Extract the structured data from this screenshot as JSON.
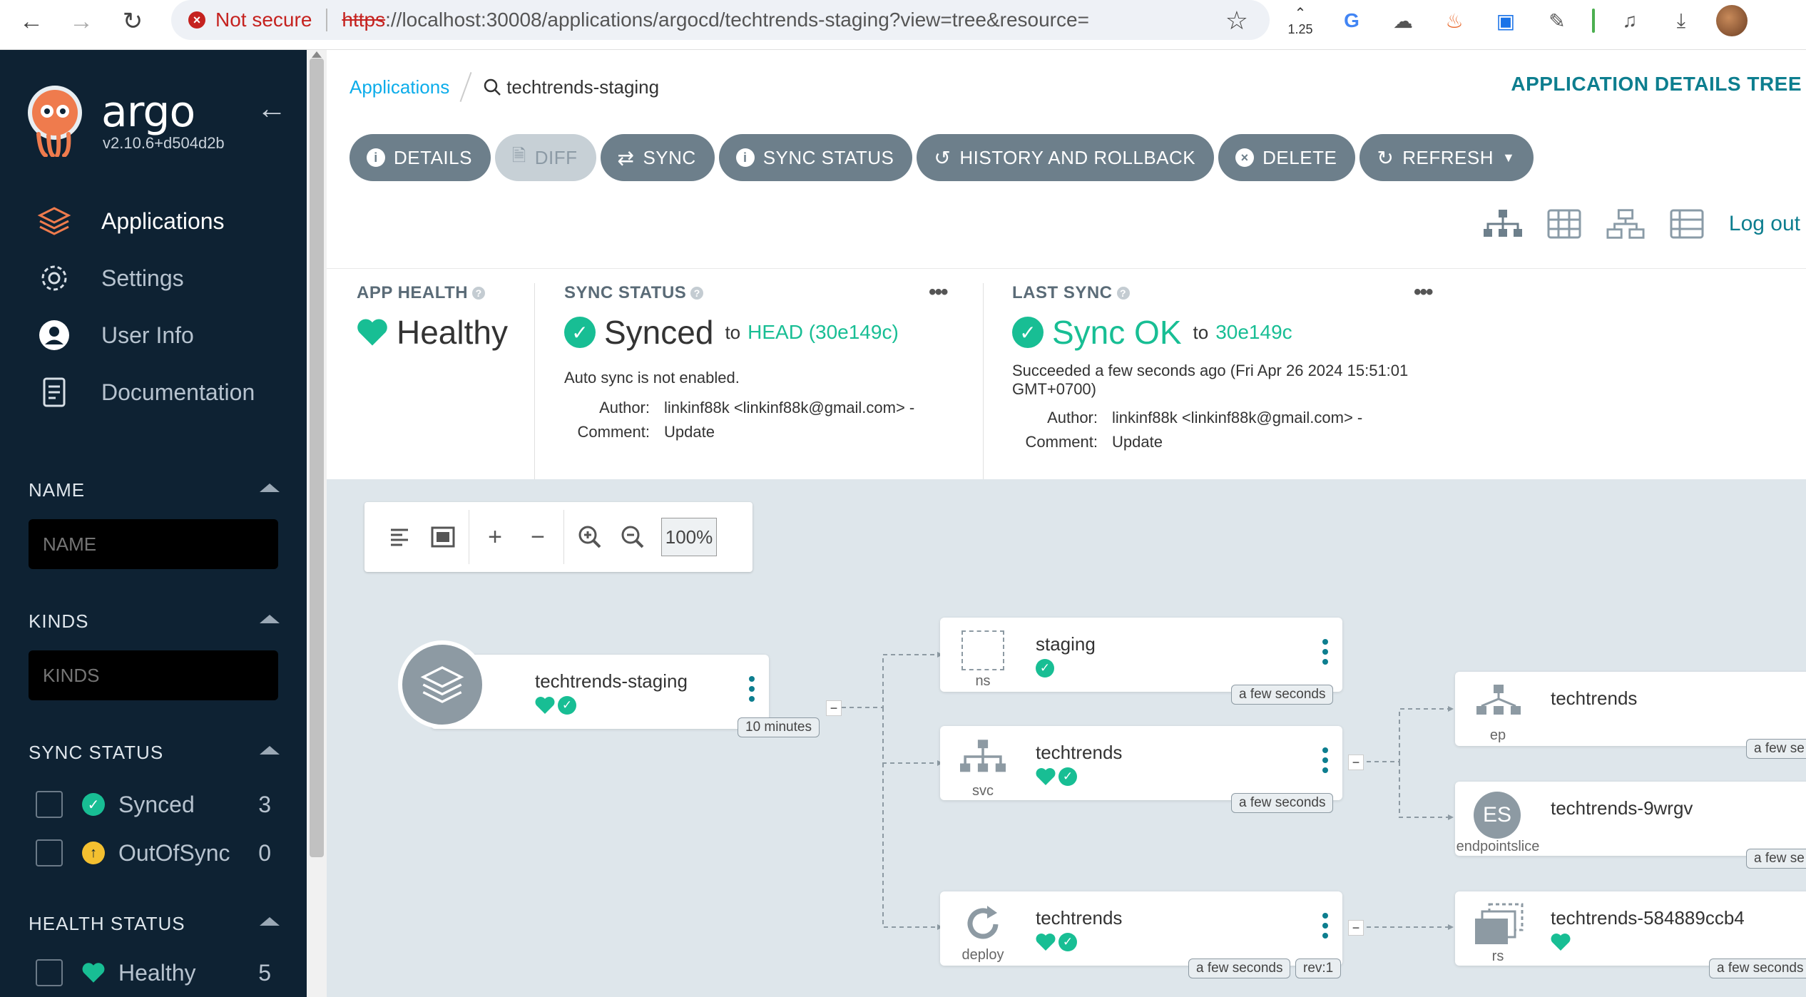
{
  "browser": {
    "not_secure": "Not secure",
    "url_scheme": "https",
    "url_rest": "://localhost:30008/applications/argocd/techtrends-staging?view=tree&resource=",
    "zoom_badge": "1.25"
  },
  "sidebar": {
    "logo_text": "argo",
    "version": "v2.10.6+d504d2b",
    "nav": [
      {
        "label": "Applications",
        "icon": "layers-icon"
      },
      {
        "label": "Settings",
        "icon": "gear-icon"
      },
      {
        "label": "User Info",
        "icon": "user-icon"
      },
      {
        "label": "Documentation",
        "icon": "book-icon"
      }
    ],
    "filters": {
      "name_label": "NAME",
      "name_placeholder": "NAME",
      "kinds_label": "KINDS",
      "kinds_placeholder": "KINDS",
      "sync_status_label": "SYNC STATUS",
      "sync_status": [
        {
          "label": "Synced",
          "count": "3"
        },
        {
          "label": "OutOfSync",
          "count": "0"
        }
      ],
      "health_status_label": "HEALTH STATUS",
      "health_status": [
        {
          "label": "Healthy",
          "count": "5"
        }
      ]
    }
  },
  "header": {
    "breadcrumb_root": "Applications",
    "breadcrumb_current": "techtrends-staging",
    "title_right": "APPLICATION DETAILS TREE",
    "logout": "Log out"
  },
  "toolbar": {
    "details": "DETAILS",
    "diff": "DIFF",
    "sync": "SYNC",
    "sync_status": "SYNC STATUS",
    "history": "HISTORY AND ROLLBACK",
    "delete": "DELETE",
    "refresh": "REFRESH"
  },
  "status": {
    "app_health_label": "APP HEALTH",
    "app_health_value": "Healthy",
    "sync_status_label": "SYNC STATUS",
    "sync_status_value": "Synced",
    "sync_to": "to",
    "sync_rev": "HEAD (30e149c)",
    "auto_sync": "Auto sync is not enabled.",
    "author_label": "Author:",
    "author_value": "linkinf88k <linkinf88k@gmail.com> -",
    "comment_label": "Comment:",
    "comment_value": "Update",
    "last_sync_label": "LAST SYNC",
    "last_sync_value": "Sync OK",
    "last_sync_to": "to",
    "last_sync_rev": "30e149c",
    "succeeded_line1": "Succeeded a few seconds ago (Fri Apr 26 2024 15:51:01",
    "succeeded_line2": "GMT+0700)",
    "ls_author_value": "linkinf88k <linkinf88k@gmail.com> -",
    "ls_comment_value": "Update"
  },
  "graph_toolbar": {
    "zoom": "100%"
  },
  "nodes": {
    "app": {
      "name": "techtrends-staging",
      "age": "10 minutes"
    },
    "ns": {
      "name": "staging",
      "kind": "ns",
      "age": "a few seconds"
    },
    "svc": {
      "name": "techtrends",
      "kind": "svc",
      "age": "a few seconds"
    },
    "deploy": {
      "name": "techtrends",
      "kind": "deploy",
      "age": "a few seconds",
      "rev": "rev:1"
    },
    "ep": {
      "name": "techtrends",
      "kind": "ep",
      "age": "a few se"
    },
    "es": {
      "name": "techtrends-9wrgv",
      "kind": "endpointslice",
      "badge": "ES",
      "age": "a few se"
    },
    "rs": {
      "name": "techtrends-584889ccb4",
      "kind": "rs",
      "age": "a few seconds"
    }
  },
  "colors": {
    "sidebar_bg": "#0e2233",
    "accent_teal": "#0d7e8f",
    "healthy_green": "#18be94",
    "graph_bg": "#dee6eb"
  }
}
